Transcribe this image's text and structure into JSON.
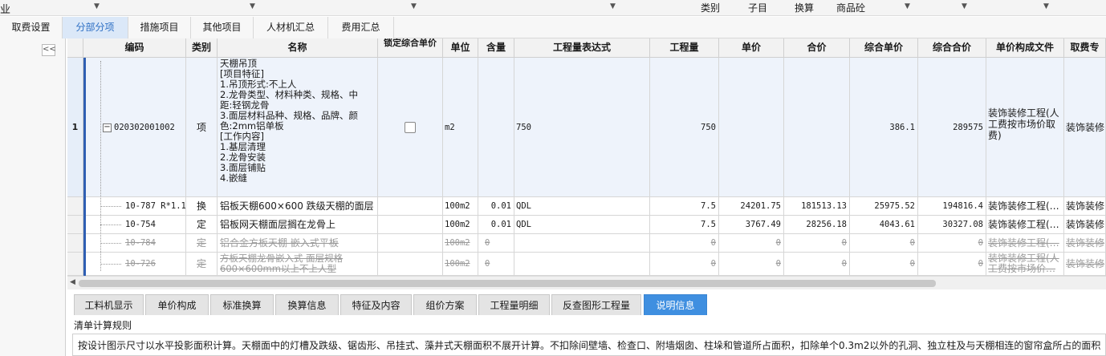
{
  "toolbar": {
    "left_label": "业",
    "items": [
      "类别",
      "子目",
      "换算",
      "商品砼"
    ]
  },
  "tabs": [
    {
      "label": "取费设置",
      "active": false
    },
    {
      "label": "分部分项",
      "active": true
    },
    {
      "label": "措施项目",
      "active": false
    },
    {
      "label": "其他项目",
      "active": false
    },
    {
      "label": "人材机汇总",
      "active": false
    },
    {
      "label": "费用汇总",
      "active": false
    }
  ],
  "collapse_glyph": "<<",
  "columns": [
    "编码",
    "类别",
    "名称",
    "锁定综合单价",
    "单位",
    "含量",
    "工程量表达式",
    "工程量",
    "单价",
    "合价",
    "综合单价",
    "综合合价",
    "单价构成文件",
    "取费专"
  ],
  "rows": [
    {
      "index": "1",
      "code": "020302001002",
      "type": "项",
      "name": "天棚吊顶\n[项目特征]\n1.吊顶形式:不上人\n2.龙骨类型、材料种类、规格、中\n距:轻钢龙骨\n3.面层材料品种、规格、品牌、颜\n色:2mm铝单板\n[工作内容]\n1.基层清理\n2.龙骨安装\n3.面层铺贴\n4.嵌缝",
      "unit": "m2",
      "content": "",
      "expr": "750",
      "qty": "750",
      "price": "",
      "total": "",
      "comp_price": "386.1",
      "comp_total": "289575",
      "file": "装饰装修工程(人\n工费按市场价取\n费)",
      "fee": "装饰装修"
    },
    {
      "code": "10-787 R*1.1",
      "type": "换",
      "name": "铝板天棚600×600  跌级天棚的面层",
      "unit": "100m2",
      "content": "0.01",
      "expr": "QDL",
      "qty": "7.5",
      "price": "24201.75",
      "total": "181513.13",
      "comp_price": "25975.52",
      "comp_total": "194816.4",
      "file": "装饰装修工程(…",
      "fee": "装饰装修"
    },
    {
      "code": "10-754",
      "type": "定",
      "name": "铝板网天棚面层搁在龙骨上",
      "unit": "100m2",
      "content": "0.01",
      "expr": "QDL",
      "qty": "7.5",
      "price": "3767.49",
      "total": "28256.18",
      "comp_price": "4043.61",
      "comp_total": "30327.08",
      "file": "装饰装修工程(…",
      "fee": "装饰装修"
    },
    {
      "code": "10-784",
      "type": "定",
      "name": "铝合金方板天棚 嵌入式平板",
      "unit": "100m2",
      "content": "0",
      "expr": "",
      "qty": "0",
      "price": "0",
      "total": "0",
      "comp_price": "0",
      "comp_total": "0",
      "file": "装饰装修工程(…",
      "fee": "装饰装修"
    },
    {
      "code": "10-726",
      "type": "定",
      "name": "方板天棚龙骨嵌入式 面层规格\n600×600mm以上不上人型",
      "unit": "100m2",
      "content": "0",
      "expr": "",
      "qty": "0",
      "price": "0",
      "total": "0",
      "comp_price": "0",
      "comp_total": "0",
      "file": "装饰装修工程(人\n工费按市场价…",
      "fee": "装饰装修"
    }
  ],
  "bottom_tabs": [
    {
      "label": "工料机显示",
      "active": false
    },
    {
      "label": "单价构成",
      "active": false
    },
    {
      "label": "标准换算",
      "active": false
    },
    {
      "label": "换算信息",
      "active": false
    },
    {
      "label": "特征及内容",
      "active": false
    },
    {
      "label": "组价方案",
      "active": false
    },
    {
      "label": "工程量明细",
      "active": false
    },
    {
      "label": "反查图形工程量",
      "active": false
    },
    {
      "label": "说明信息",
      "active": true
    }
  ],
  "rules": {
    "title": "清单计算规则",
    "text": "按设计图示尺寸以水平投影面积计算。天棚面中的灯槽及跌级、锯齿形、吊挂式、藻井式天棚面积不展开计算。不扣除间壁墙、检查口、附墙烟囱、柱垛和管道所占面积，扣除单个0.3m2以外的孔洞、独立柱及与天棚相连的窗帘盒所占的面积"
  },
  "colors": {
    "accent": "#3f8fe0",
    "active_tab_bg": "#dbe8f8",
    "selection_bar": "#2f5fb3"
  }
}
